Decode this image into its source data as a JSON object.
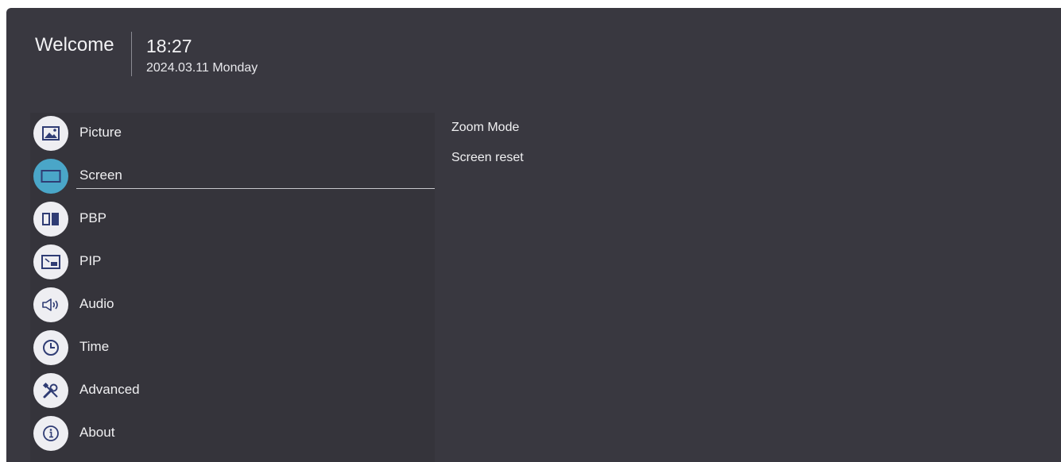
{
  "header": {
    "welcome": "Welcome",
    "time": "18:27",
    "date": "2024.03.11 Monday"
  },
  "menu": {
    "items": [
      {
        "label": "Picture",
        "icon": "picture-icon"
      },
      {
        "label": "Screen",
        "icon": "screen-icon",
        "selected": true
      },
      {
        "label": "PBP",
        "icon": "pbp-icon"
      },
      {
        "label": "PIP",
        "icon": "pip-icon"
      },
      {
        "label": "Audio",
        "icon": "speaker-icon"
      },
      {
        "label": "Time",
        "icon": "clock-icon"
      },
      {
        "label": "Advanced",
        "icon": "tools-icon"
      },
      {
        "label": "About",
        "icon": "info-icon"
      }
    ]
  },
  "options": {
    "items": [
      "Zoom Mode",
      "Screen reset"
    ]
  },
  "colors": {
    "background": "#393840",
    "menu_background": "#35343b",
    "accent": "#4aa6c8",
    "icon_glyph": "#2f3c74"
  }
}
